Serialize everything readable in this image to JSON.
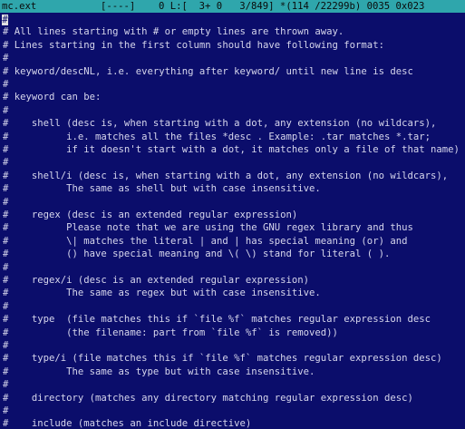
{
  "status": {
    "filename": "mc.ext",
    "mode": "[----]",
    "position": "0 L:[  3+ 0   3/849] *(114 /22299b) 0035 0x023"
  },
  "editor": {
    "cursor_char": "#",
    "lines": [
      "#",
      "# All lines starting with # or empty lines are thrown away.",
      "# Lines starting in the first column should have following format:",
      "#",
      "# keyword/descNL, i.e. everything after keyword/ until new line is desc",
      "#",
      "# keyword can be:",
      "#",
      "#    shell (desc is, when starting with a dot, any extension (no wildcars),",
      "#          i.e. matches all the files *desc . Example: .tar matches *.tar;",
      "#          if it doesn't start with a dot, it matches only a file of that name)",
      "#",
      "#    shell/i (desc is, when starting with a dot, any extension (no wildcars),",
      "#          The same as shell but with case insensitive.",
      "#",
      "#    regex (desc is an extended regular expression)",
      "#          Please note that we are using the GNU regex library and thus",
      "#          \\| matches the literal | and | has special meaning (or) and",
      "#          () have special meaning and \\( \\) stand for literal ( ).",
      "#",
      "#    regex/i (desc is an extended regular expression)",
      "#          The same as regex but with case insensitive.",
      "#",
      "#    type  (file matches this if `file %f` matches regular expression desc",
      "#          (the filename: part from `file %f` is removed))",
      "#",
      "#    type/i (file matches this if `file %f` matches regular expression desc)",
      "#          The same as type but with case insensitive.",
      "#",
      "#    directory (matches any directory matching regular expression desc)",
      "#",
      "#    include (matches an include directive)"
    ]
  }
}
